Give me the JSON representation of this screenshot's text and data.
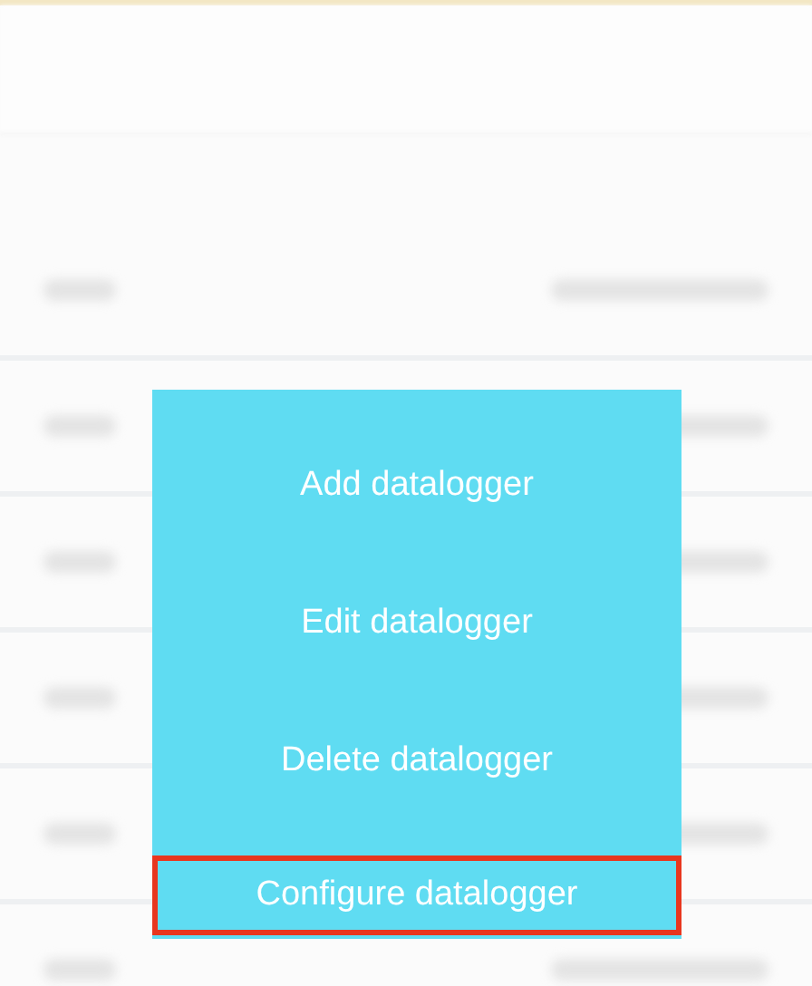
{
  "menu": {
    "items": [
      {
        "label": "Add datalogger",
        "highlighted": false
      },
      {
        "label": "Edit datalogger",
        "highlighted": false
      },
      {
        "label": "Delete datalogger",
        "highlighted": false
      },
      {
        "label": "Configure datalogger",
        "highlighted": true
      }
    ]
  }
}
